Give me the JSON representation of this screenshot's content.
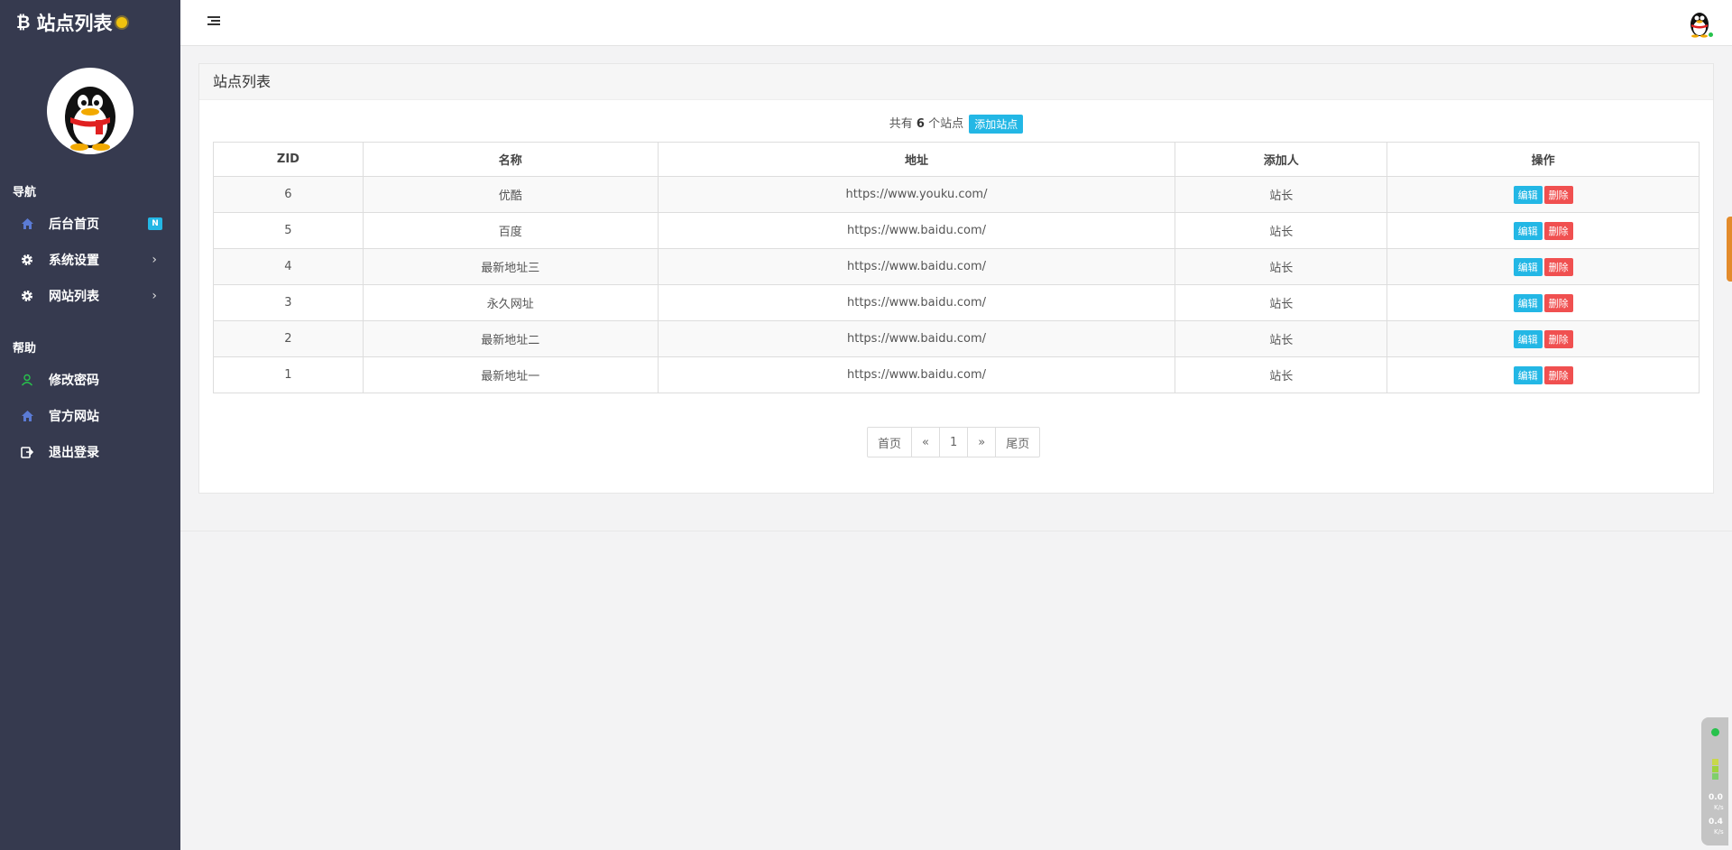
{
  "brand": {
    "title": "站点列表"
  },
  "nav": {
    "heading_nav": "导航",
    "heading_help": "帮助",
    "items": [
      {
        "label": "后台首页",
        "badge": "N"
      },
      {
        "label": "系统设置"
      },
      {
        "label": "网站列表"
      }
    ],
    "help_items": [
      {
        "label": "修改密码"
      },
      {
        "label": "官方网站"
      },
      {
        "label": "退出登录"
      }
    ]
  },
  "panel": {
    "title": "站点列表",
    "summary_prefix": "共有",
    "count": "6",
    "summary_suffix": "个站点",
    "add_button": "添加站点"
  },
  "table": {
    "headers": [
      "ZID",
      "名称",
      "地址",
      "添加人",
      "操作"
    ],
    "rows": [
      {
        "zid": "6",
        "name": "优酷",
        "url": "https://www.youku.com/",
        "adder": "站长"
      },
      {
        "zid": "5",
        "name": "百度",
        "url": "https://www.baidu.com/",
        "adder": "站长"
      },
      {
        "zid": "4",
        "name": "最新地址三",
        "url": "https://www.baidu.com/",
        "adder": "站长"
      },
      {
        "zid": "3",
        "name": "永久网址",
        "url": "https://www.baidu.com/",
        "adder": "站长"
      },
      {
        "zid": "2",
        "name": "最新地址二",
        "url": "https://www.baidu.com/",
        "adder": "站长"
      },
      {
        "zid": "1",
        "name": "最新地址一",
        "url": "https://www.baidu.com/",
        "adder": "站长"
      }
    ],
    "edit_label": "编辑",
    "delete_label": "删除"
  },
  "pagination": {
    "first": "首页",
    "prev": "«",
    "current": "1",
    "next": "»",
    "last": "尾页"
  },
  "speed_widget": {
    "up": "0.0",
    "down": "0.4",
    "unit": "K/s"
  },
  "colors": {
    "sidebar": "#363a4f",
    "info": "#23b7e5",
    "danger": "#f05050",
    "accent_orange": "#e38b2b"
  },
  "icons": {
    "brand": "bitcoin-icon",
    "home": "home-icon",
    "settings": "gear-icon",
    "user": "user-icon",
    "logout": "logout-icon",
    "menu": "menu-toggle-icon"
  }
}
